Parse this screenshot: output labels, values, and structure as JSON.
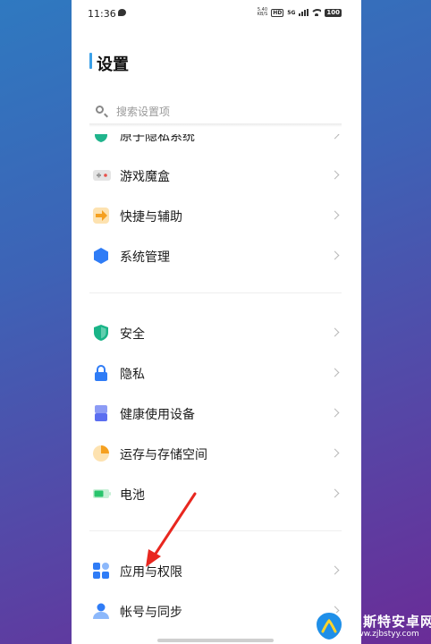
{
  "status_bar": {
    "time": "11:36",
    "net_speed_value": "5.40",
    "net_speed_unit": "KB/S",
    "hd_label": "HD",
    "signal_label": "5G",
    "battery": "100"
  },
  "header": {
    "title": "设置"
  },
  "search": {
    "placeholder": "搜索设置项"
  },
  "settings": {
    "items": [
      {
        "label": "原子隐私系统",
        "icon": "privacy-system-icon",
        "color": "#20b48c"
      },
      {
        "label": "游戏魔盒",
        "icon": "game-box-icon",
        "color": "#e0e0e0"
      },
      {
        "label": "快捷与辅助",
        "icon": "shortcut-icon",
        "color": "#f7a928"
      },
      {
        "label": "系统管理",
        "icon": "system-manage-icon",
        "color": "#2f7cf6"
      },
      {
        "label": "安全",
        "icon": "shield-icon",
        "color": "#19b487"
      },
      {
        "label": "隐私",
        "icon": "lock-icon",
        "color": "#2f7cf6"
      },
      {
        "label": "健康使用设备",
        "icon": "hourglass-icon",
        "color": "#5b6ef0"
      },
      {
        "label": "运存与存储空间",
        "icon": "storage-pie-icon",
        "color": "#f7a928"
      },
      {
        "label": "电池",
        "icon": "battery-icon",
        "color": "#28c46c"
      },
      {
        "label": "应用与权限",
        "icon": "apps-grid-icon",
        "color": "#2f7cf6"
      },
      {
        "label": "帐号与同步",
        "icon": "account-icon",
        "color": "#2f7cf6"
      }
    ]
  },
  "annotation": {
    "arrow_color": "#e8271f"
  },
  "watermark": {
    "title": "贝斯特安卓网",
    "url": "www.zjbstyy.com"
  }
}
